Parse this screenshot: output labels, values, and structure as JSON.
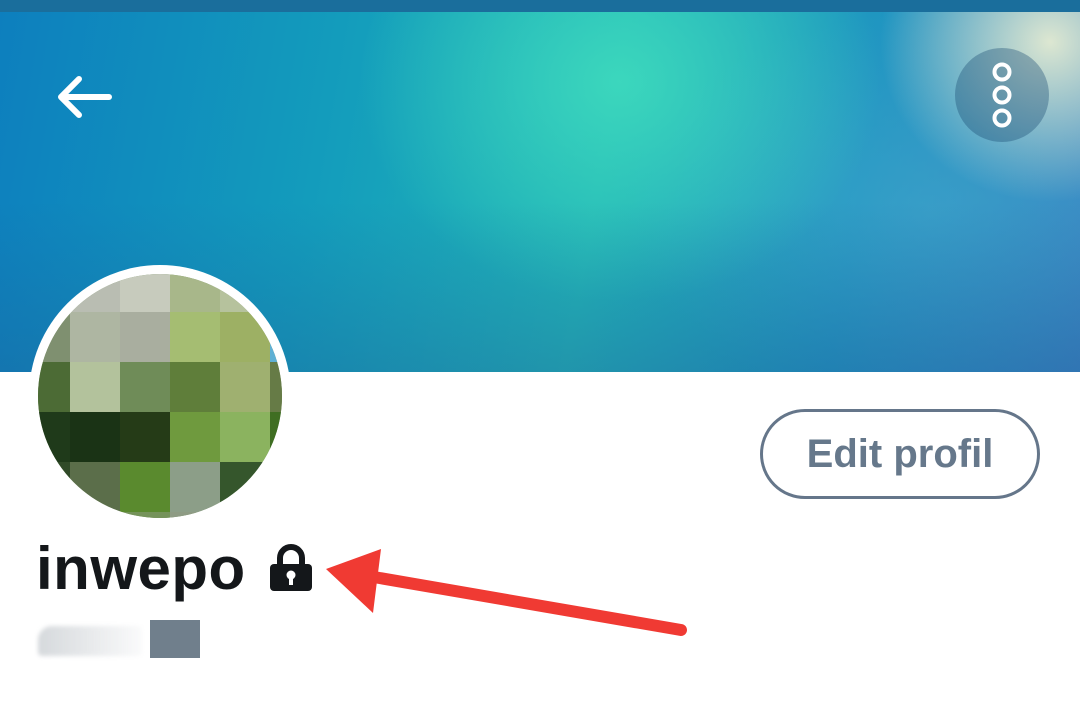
{
  "banner": {
    "back_icon": "arrow-left-icon",
    "more_icon": "vertical-dots-icon"
  },
  "profile": {
    "display_name": "inwepo",
    "lock_icon": "lock-icon",
    "edit_button_label": "Edit profil"
  },
  "colors": {
    "annotation_arrow": "#f03a33",
    "button_text": "#66788b",
    "name_text": "#14171a"
  }
}
